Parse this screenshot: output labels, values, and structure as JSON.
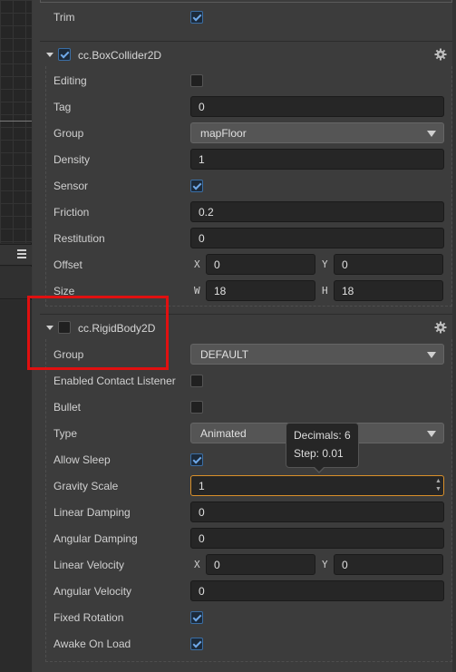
{
  "trim": {
    "label": "Trim",
    "checked": true
  },
  "box_collider": {
    "title": "cc.BoxCollider2D",
    "enabled": true,
    "editing": {
      "label": "Editing",
      "checked": false
    },
    "tag": {
      "label": "Tag",
      "value": "0"
    },
    "group": {
      "label": "Group",
      "value": "mapFloor"
    },
    "density": {
      "label": "Density",
      "value": "1"
    },
    "sensor": {
      "label": "Sensor",
      "checked": true
    },
    "friction": {
      "label": "Friction",
      "value": "0.2"
    },
    "restitution": {
      "label": "Restitution",
      "value": "0"
    },
    "offset": {
      "label": "Offset",
      "x_label": "X",
      "x": "0",
      "y_label": "Y",
      "y": "0"
    },
    "size": {
      "label": "Size",
      "w_label": "W",
      "w": "18",
      "h_label": "H",
      "h": "18"
    }
  },
  "rigid_body": {
    "title": "cc.RigidBody2D",
    "enabled": false,
    "group": {
      "label": "Group",
      "value": "DEFAULT"
    },
    "enabled_contact_listener": {
      "label": "Enabled Contact Listener",
      "checked": false
    },
    "bullet": {
      "label": "Bullet",
      "checked": false
    },
    "type": {
      "label": "Type",
      "value": "Animated"
    },
    "allow_sleep": {
      "label": "Allow Sleep",
      "checked": true
    },
    "gravity_scale": {
      "label": "Gravity Scale",
      "value": "1"
    },
    "linear_damping": {
      "label": "Linear Damping",
      "value": "0"
    },
    "angular_damping": {
      "label": "Angular Damping",
      "value": "0"
    },
    "linear_velocity": {
      "label": "Linear Velocity",
      "x_label": "X",
      "x": "0",
      "y_label": "Y",
      "y": "0"
    },
    "angular_velocity": {
      "label": "Angular Velocity",
      "value": "0"
    },
    "fixed_rotation": {
      "label": "Fixed Rotation",
      "checked": true
    },
    "awake_on_load": {
      "label": "Awake On Load",
      "checked": true
    }
  },
  "tooltip": {
    "decimals": "Decimals: 6",
    "step": "Step: 0.01"
  },
  "colors": {
    "accent": "#3a6ea5",
    "focus": "#d9902a",
    "highlight": "#e01010"
  }
}
